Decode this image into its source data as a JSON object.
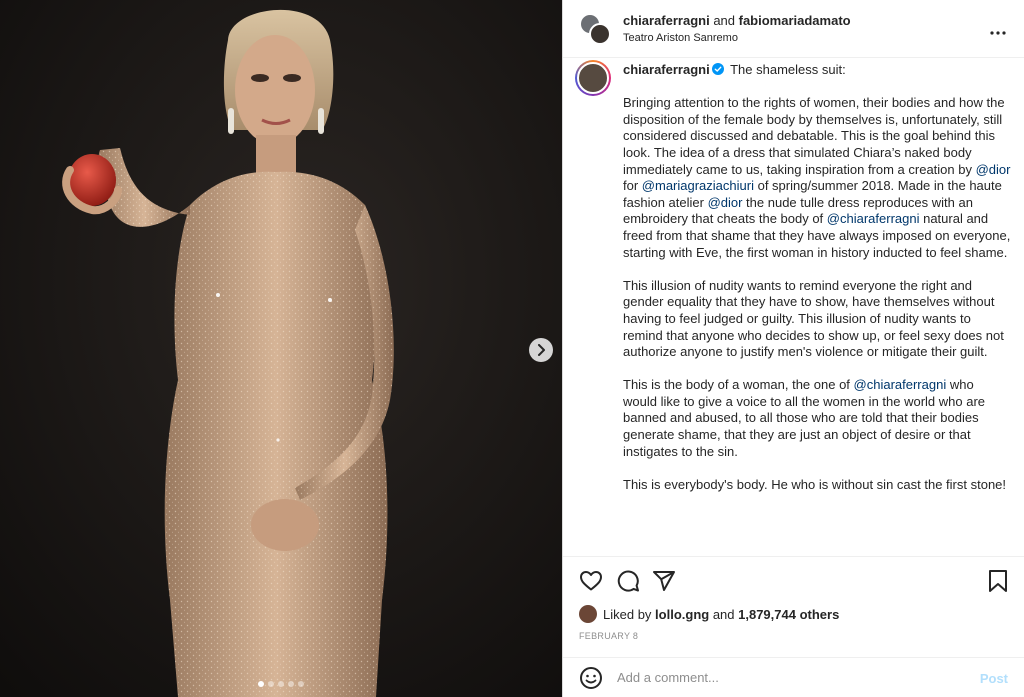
{
  "header": {
    "user1": "chiaraferragni",
    "and": " and ",
    "user2": "fabiomariadamato",
    "location": "Teatro Ariston Sanremo"
  },
  "caption": {
    "username": "chiaraferragni",
    "title": "The shameless suit:",
    "p1_a": "Bringing attention to the rights of women, their bodies and how the disposition of the female body by themselves is, unfortunately, still considered discussed and debatable. This is the goal behind this look. The idea of a dress that simulated Chiara’s naked body immediately came to us, taking inspiration from a creation by ",
    "p1_m1": "@dior",
    "p1_b": " for ",
    "p1_m2": "@mariagraziachiuri",
    "p1_c": " of spring/summer 2018. Made in the haute fashion atelier ",
    "p1_m3": "@dior",
    "p1_d": " the nude tulle dress reproduces with an embroidery that cheats the body of ",
    "p1_m4": "@chiaraferragni",
    "p1_e": " natural and freed from that shame that they have always imposed on everyone, starting with Eve, the first woman in history inducted to feel shame.",
    "p2": "This illusion of nudity wants to remind everyone the right and gender equality that they have to show, have themselves without having to feel judged or guilty. This illusion of nudity wants to remind that anyone who decides to show up, or feel sexy does not authorize anyone to justify men's violence or mitigate their guilt.",
    "p3_a": "This is the body of a woman, the one of ",
    "p3_m1": "@chiaraferragni",
    "p3_b": " who would like to give a voice to all the women in the world who are banned and abused, to all those who are told that their bodies generate shame, that they are just an object of desire or that instigates to the sin.",
    "p4": "This is everybody's body. He who is without sin cast the first stone!"
  },
  "likes": {
    "prefix": "Liked by ",
    "user": "lollo.gng",
    "mid": " and ",
    "count": "1,879,744 others"
  },
  "date": "FEBRUARY 8",
  "comment": {
    "placeholder": "Add a comment...",
    "post_label": "Post"
  },
  "carousel": {
    "total": 5,
    "active_index": 0
  },
  "colors": {
    "mention": "#00376b",
    "verified": "#0095f6",
    "post_disabled": "#b2dffc",
    "muted": "#8e8e8e"
  },
  "icons": [
    "more-icon",
    "verified-icon",
    "heart-icon",
    "comment-icon",
    "share-icon",
    "bookmark-icon",
    "emoji-icon",
    "chevron-right-icon"
  ]
}
